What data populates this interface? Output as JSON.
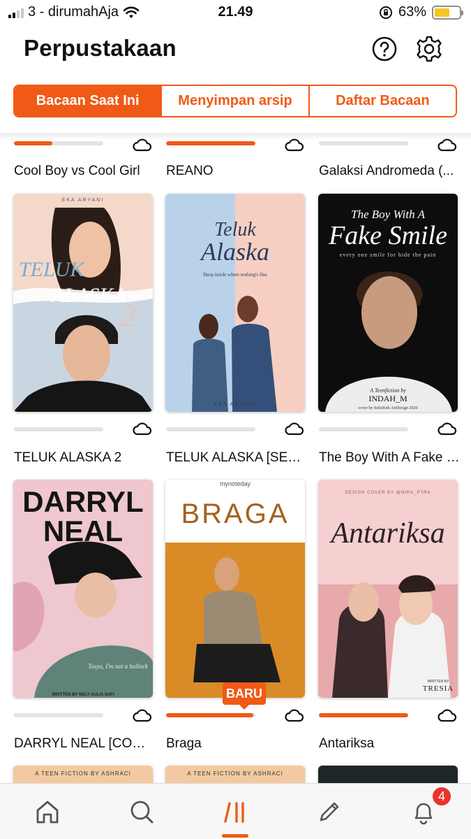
{
  "status_bar": {
    "carrier": "3 - dirumahAja",
    "time": "21.49",
    "battery": "63%",
    "battery_level": 0.63
  },
  "header": {
    "title": "Perpustakaan",
    "icons": [
      "help-icon",
      "gear-icon"
    ]
  },
  "tabs": [
    {
      "label": "Bacaan Saat Ini",
      "active": true
    },
    {
      "label": "Menyimpan arsip",
      "active": false
    },
    {
      "label": "Daftar Bacaan",
      "active": false
    }
  ],
  "books": [
    {
      "title": "Cool Boy vs Cool Girl",
      "progress": 0.43
    },
    {
      "title": "REANO",
      "progress": 1.0
    },
    {
      "title": "Galaksi Andromeda (...",
      "progress": 0
    },
    {
      "title": "TELUK ALASKA 2",
      "progress": 0,
      "cover_texts": [
        "EKA ARYANI",
        "TELUK",
        "ALASKA",
        "2"
      ]
    },
    {
      "title": "TELUK ALASKA [SELE...",
      "progress": 0,
      "cover_texts": [
        "Teluk",
        "Alaska",
        "Deep inside where nothing's fine",
        "EKA ARYANI"
      ]
    },
    {
      "title": "The Boy With A Fake S...",
      "progress": 0,
      "cover_texts": [
        "The Boy With A",
        "Fake Smile",
        "every one smile for hide the pain",
        "A Teenfiction by",
        "INDAH_M",
        "cover by SulisPark ArtDesign 2020"
      ]
    },
    {
      "title": "DARRYL NEAL [COMPL...",
      "progress": 0,
      "cover_texts": [
        "DARRYL",
        "NEAL",
        "Tasya, I'm not a bullock",
        "WRITTEN BY NELY AULIA SOFI"
      ]
    },
    {
      "title": "Braga",
      "progress": 0.98,
      "badge": "BARU",
      "cover_texts": [
        "mynoteday",
        "BRAGA"
      ]
    },
    {
      "title": "Antariksa",
      "progress": 1.0,
      "cover_texts": [
        "DESIGN COVER BY @NIRA_PTRA",
        "Antariksa",
        "WRITTEN BY",
        "TRESIA"
      ]
    }
  ],
  "partial_covers": [
    "A TEEN FICTION BY ASHRACI",
    "A TEEN FICTION BY ASHRACI"
  ],
  "bottom_nav": {
    "items": [
      "home-icon",
      "search-icon",
      "library-icon",
      "write-icon",
      "bell-icon"
    ],
    "active": "library-icon",
    "notification_count": "4"
  },
  "colors": {
    "accent": "#f05a16",
    "badge_red": "#e8332e"
  }
}
